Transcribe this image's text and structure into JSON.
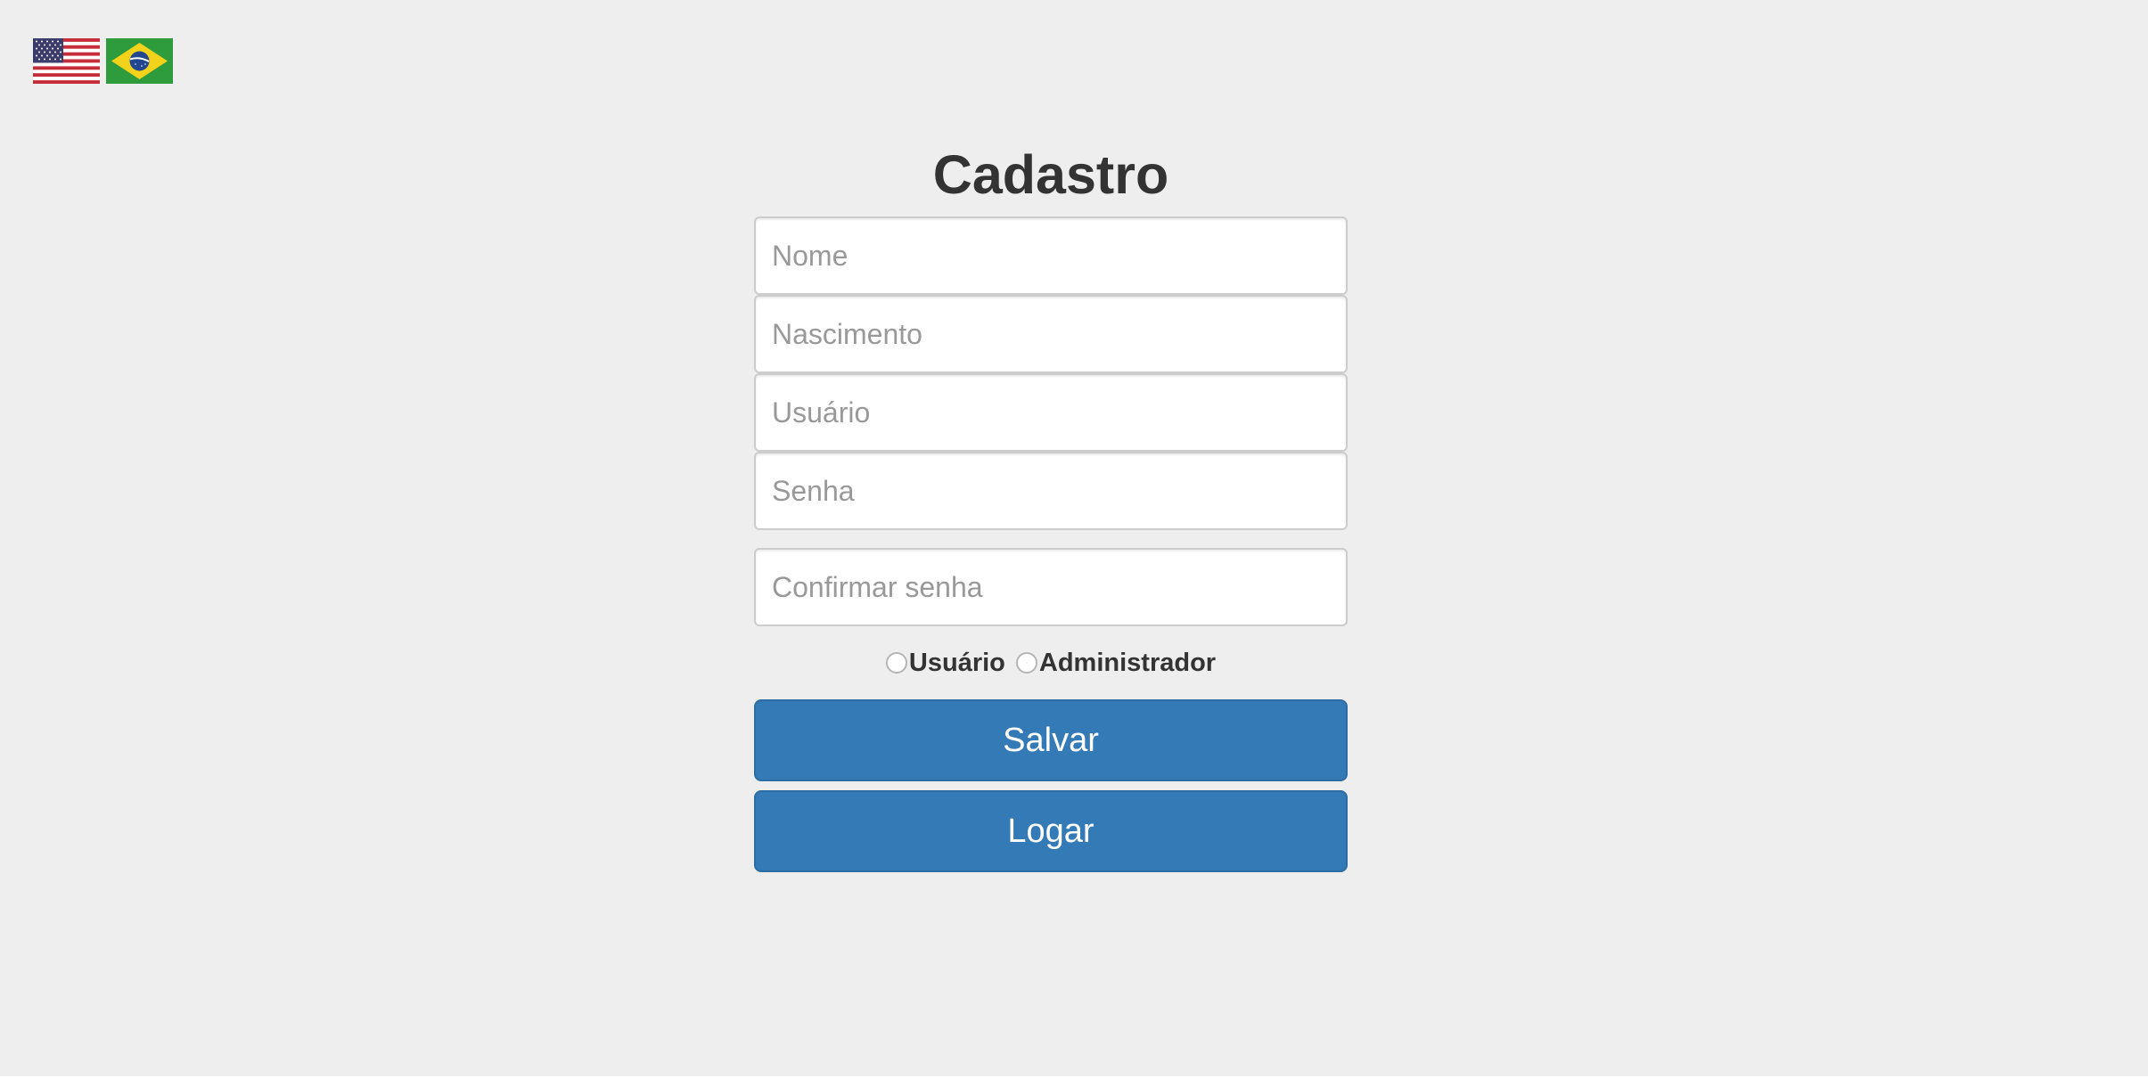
{
  "language_flags": [
    {
      "name": "English (US)",
      "icon": "us-flag-icon"
    },
    {
      "name": "Português (Brasil)",
      "icon": "brazil-flag-icon"
    }
  ],
  "form": {
    "title": "Cadastro",
    "fields": {
      "nome": {
        "placeholder": "Nome",
        "value": ""
      },
      "nascimento": {
        "placeholder": "Nascimento",
        "value": ""
      },
      "usuario": {
        "placeholder": "Usuário",
        "value": ""
      },
      "senha": {
        "placeholder": "Senha",
        "value": ""
      },
      "confirmar_senha": {
        "placeholder": "Confirmar senha",
        "value": ""
      }
    },
    "role_options": [
      {
        "label": "Usuário",
        "selected": false
      },
      {
        "label": "Administrador",
        "selected": false
      }
    ],
    "buttons": {
      "save_label": "Salvar",
      "login_label": "Logar"
    }
  },
  "colors": {
    "background": "#eeeeee",
    "primary": "#337ab7",
    "primary_border": "#2e6da4",
    "text": "#333333",
    "placeholder": "#999999"
  }
}
